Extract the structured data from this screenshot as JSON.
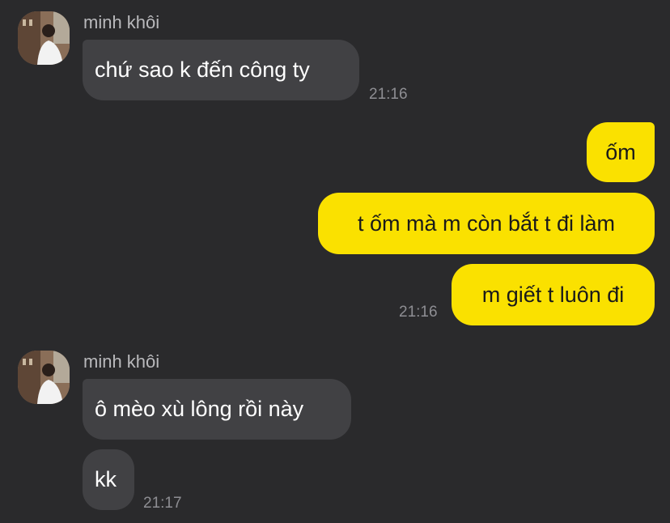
{
  "groups": [
    {
      "sender": "minh khôi",
      "avatar_icon": "profile-photo-icon",
      "messages": [
        {
          "text": "chứ sao k đến công ty",
          "time": "21:16"
        }
      ]
    },
    {
      "sender": "me",
      "messages": [
        {
          "text": "ốm"
        },
        {
          "text": "t ốm mà m còn bắt t đi làm"
        },
        {
          "text": "m giết t luôn đi",
          "time": "21:16"
        }
      ]
    },
    {
      "sender": "minh khôi",
      "avatar_icon": "profile-photo-icon",
      "messages": [
        {
          "text": "ô mèo xù lông rồi này"
        },
        {
          "text": "kk",
          "time": "21:17"
        }
      ]
    }
  ],
  "colors": {
    "background": "#2a2a2c",
    "incoming_bubble": "#414144",
    "outgoing_bubble": "#fae100",
    "timestamp": "#8e8e93",
    "sender_name": "#b9b9bc"
  }
}
